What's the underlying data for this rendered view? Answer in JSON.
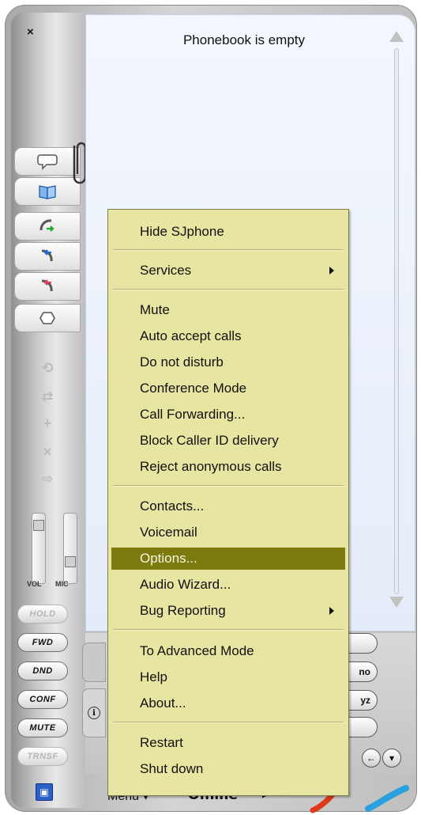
{
  "window": {
    "close_glyph": "×"
  },
  "phonebook": {
    "title": "Phonebook is empty"
  },
  "side_tabs": [
    {
      "name": "messages",
      "icon": "speech-bubble-icon"
    },
    {
      "name": "phonebook",
      "icon": "book-icon",
      "active": true
    },
    {
      "name": "call-out",
      "icon": "phone-outgoing-icon"
    },
    {
      "name": "call-in",
      "icon": "phone-incoming-icon"
    },
    {
      "name": "missed",
      "icon": "phone-missed-icon"
    },
    {
      "name": "settings",
      "icon": "gear-icon"
    }
  ],
  "sliders": {
    "vol_label": "VOL",
    "mic_label": "MIC"
  },
  "call_buttons": [
    {
      "label": "HOLD",
      "enabled": false
    },
    {
      "label": "FWD",
      "enabled": true
    },
    {
      "label": "DND",
      "enabled": true
    },
    {
      "label": "CONF",
      "enabled": true
    },
    {
      "label": "MUTE",
      "enabled": true
    },
    {
      "label": "TRNSF",
      "enabled": false
    }
  ],
  "keypad_visible": [
    "no",
    "yz"
  ],
  "status_bar": {
    "menu_label": "Menu",
    "status_text": "Offline"
  },
  "context_menu": {
    "groups": [
      [
        "Hide SJphone"
      ],
      [
        "Services"
      ],
      [
        "Mute",
        "Auto accept calls",
        "Do not disturb",
        "Conference Mode",
        "Call Forwarding...",
        "Block Caller ID delivery",
        "Reject anonymous calls"
      ],
      [
        "Contacts...",
        "Voicemail",
        "Options...",
        "Audio Wizard...",
        "Bug Reporting"
      ],
      [
        "To Advanced Mode",
        "Help",
        "About..."
      ],
      [
        "Restart",
        "Shut down"
      ]
    ],
    "items": {
      "hide": "Hide SJphone",
      "services": "Services",
      "mute": "Mute",
      "auto_accept": "Auto accept calls",
      "dnd": "Do not disturb",
      "conference": "Conference Mode",
      "forwarding": "Call Forwarding...",
      "block_caller_id": "Block Caller ID delivery",
      "reject_anon": "Reject anonymous calls",
      "contacts": "Contacts...",
      "voicemail": "Voicemail",
      "options": "Options...",
      "audio_wizard": "Audio Wizard...",
      "bug_reporting": "Bug Reporting",
      "advanced_mode": "To Advanced Mode",
      "help": "Help",
      "about": "About...",
      "restart": "Restart",
      "shutdown": "Shut down"
    },
    "selected": "Options...",
    "highlight_color": "#7d7a10",
    "background_color": "#e6e5a1"
  }
}
